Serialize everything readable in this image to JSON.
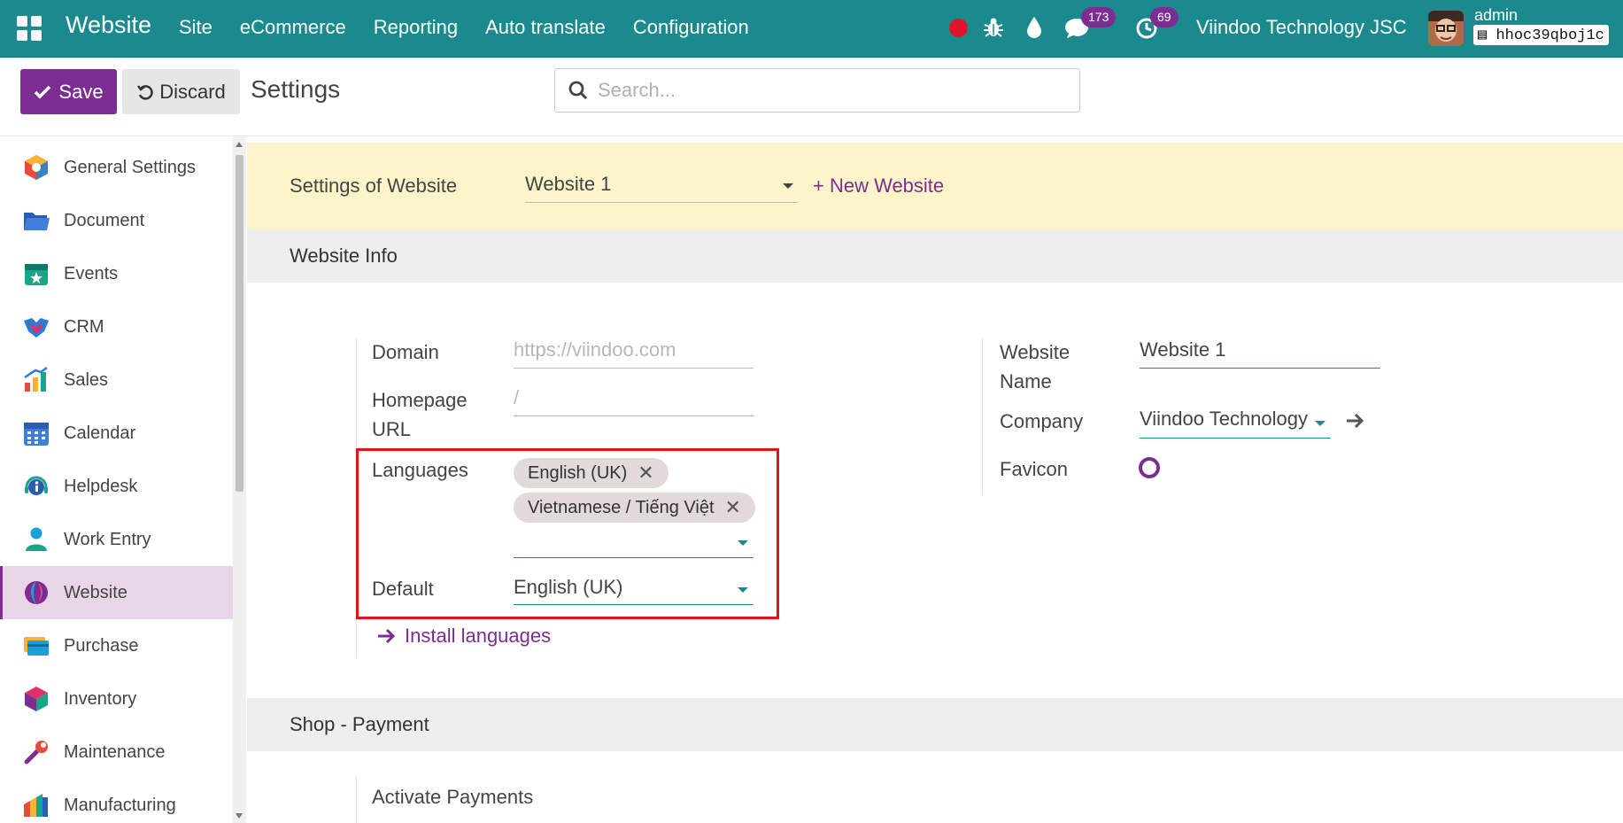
{
  "navbar": {
    "app_name": "Website",
    "menu": [
      "Site",
      "eCommerce",
      "Reporting",
      "Auto translate",
      "Configuration"
    ],
    "messages_count": "173",
    "activities_count": "69",
    "company": "Viindoo Technology JSC",
    "user": "admin",
    "database": "hhoc39qboj1c"
  },
  "control": {
    "save_label": "Save",
    "discard_label": "Discard",
    "title": "Settings",
    "search_placeholder": "Search..."
  },
  "sidebar": {
    "items": [
      {
        "label": "General Settings",
        "icon": "general-settings-icon"
      },
      {
        "label": "Document",
        "icon": "document-icon"
      },
      {
        "label": "Events",
        "icon": "events-icon"
      },
      {
        "label": "CRM",
        "icon": "crm-icon"
      },
      {
        "label": "Sales",
        "icon": "sales-icon"
      },
      {
        "label": "Calendar",
        "icon": "calendar-icon"
      },
      {
        "label": "Helpdesk",
        "icon": "helpdesk-icon"
      },
      {
        "label": "Work Entry",
        "icon": "work-entry-icon"
      },
      {
        "label": "Website",
        "icon": "website-icon",
        "active": true
      },
      {
        "label": "Purchase",
        "icon": "purchase-icon"
      },
      {
        "label": "Inventory",
        "icon": "inventory-icon"
      },
      {
        "label": "Maintenance",
        "icon": "maintenance-icon"
      },
      {
        "label": "Manufacturing",
        "icon": "manufacturing-icon"
      }
    ]
  },
  "banner": {
    "label": "Settings of Website",
    "selected_website": "Website 1",
    "new_website": "+ New Website"
  },
  "website_info": {
    "title": "Website Info",
    "domain_label": "Domain",
    "domain_placeholder": "https://viindoo.com",
    "homepage_label": "Homepage URL",
    "homepage_placeholder": "/",
    "languages_label": "Languages",
    "languages": [
      "English (UK)",
      "Vietnamese / Tiếng Việt"
    ],
    "default_label": "Default",
    "default_value": "English (UK)",
    "install_languages": "Install languages",
    "website_name_label": "Website Name",
    "website_name_value": "Website 1",
    "company_label": "Company",
    "company_value": "Viindoo Technology",
    "favicon_label": "Favicon"
  },
  "shop_payment": {
    "title": "Shop - Payment",
    "activate_payments": "Activate Payments"
  },
  "colors": {
    "navbar": "#1a8a8f",
    "primary": "#7c2d91",
    "highlight": "#e0151c"
  }
}
